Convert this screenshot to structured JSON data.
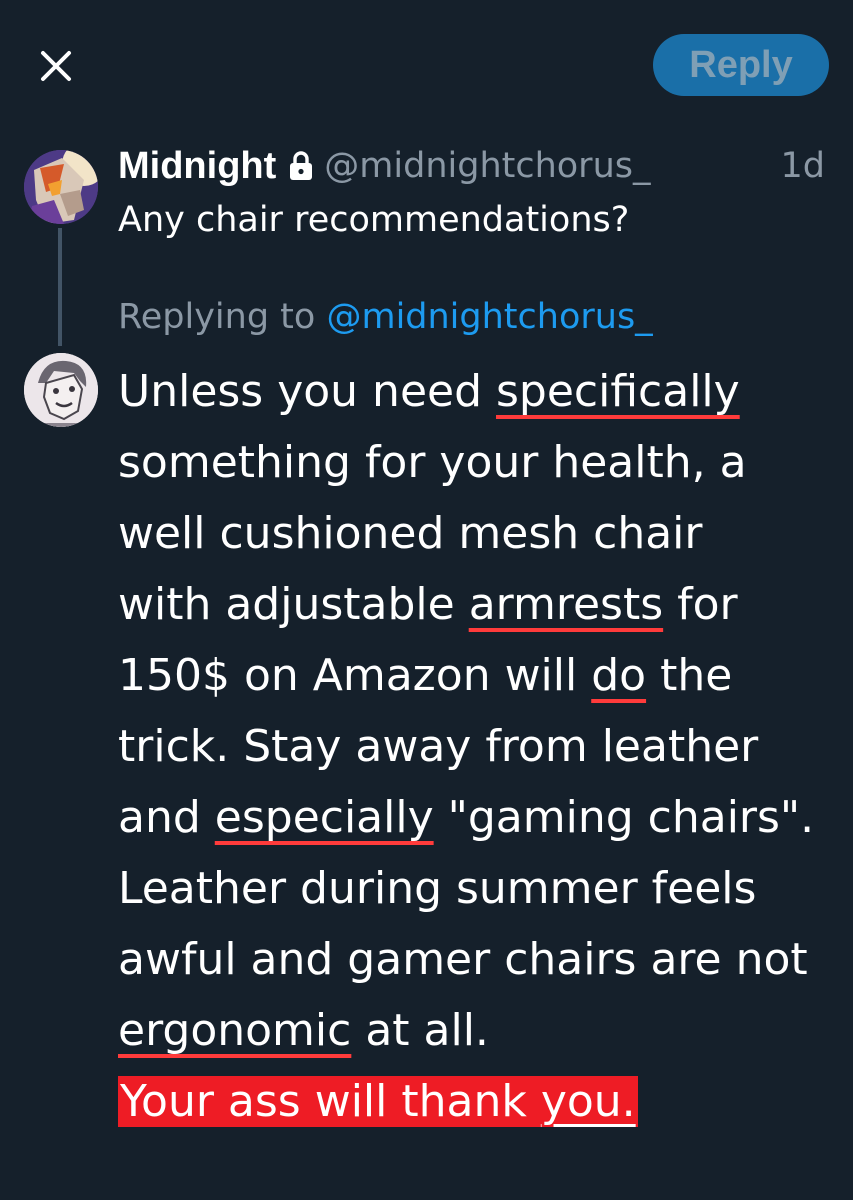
{
  "header": {
    "close_icon": "close-icon",
    "reply_label": "Reply"
  },
  "tweet": {
    "author_name": "Midnight",
    "author_locked_icon": "lock-icon",
    "author_handle": "@midnightchorus_",
    "time": "1d",
    "text": "Any chair recommendations?"
  },
  "reply": {
    "replying_prefix": "Replying to",
    "replying_handle": "@midnightchorus_",
    "lines": [
      [
        "Unless you need ",
        "specifically"
      ],
      [
        "something for your health, a"
      ],
      [
        "well cushioned mesh chair"
      ],
      [
        "with adjustable ",
        "armrests",
        " for"
      ],
      [
        "150$ on Amazon will ",
        "do",
        " the"
      ],
      [
        "trick. Stay away from leather"
      ],
      [
        "and ",
        "especially",
        " \"gaming chairs\"."
      ],
      [
        "Leather during summer feels"
      ],
      [
        "awful and gamer chairs are not"
      ],
      [
        "ergonomic",
        " at all."
      ]
    ],
    "highlight_text": "Your ass will thank ",
    "highlight_underlined": "you."
  },
  "colors": {
    "background": "#15202b",
    "accent": "#1d9bf0",
    "underline": "#ff3b3b",
    "highlight": "#ee1c25"
  }
}
